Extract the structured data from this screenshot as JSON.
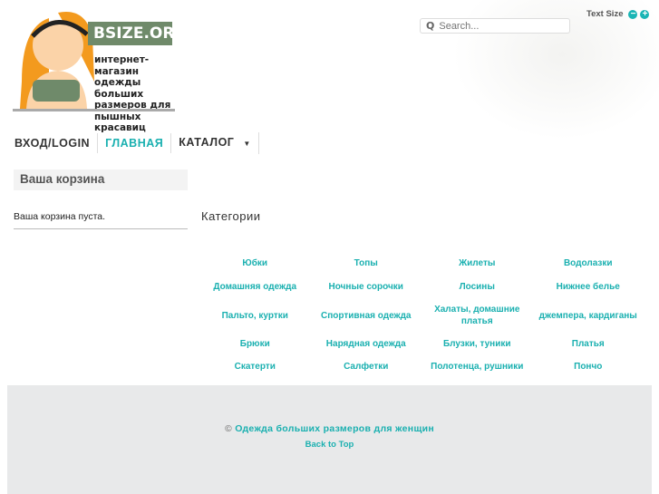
{
  "logo": {
    "title": "BSIZE.ORG",
    "tagline": "интернет-магазин одежды больших размеров для пышных красавиц"
  },
  "search": {
    "placeholder": "Search..."
  },
  "text_size": {
    "label": "Text Size",
    "minus": "−",
    "plus": "+"
  },
  "nav": [
    {
      "label": "ВХОД/LOGIN"
    },
    {
      "label": "ГЛАВНАЯ"
    },
    {
      "label": "КАТАЛОГ"
    }
  ],
  "cart": {
    "title": "Ваша корзина",
    "empty": "Ваша корзина пуста."
  },
  "categories": {
    "title": "Категории",
    "items": [
      "Юбки",
      "Топы",
      "Жилеты",
      "Водолазки",
      "Домашняя одежда",
      "Ночные сорочки",
      "Лосины",
      "Нижнее белье",
      "Пальто, куртки",
      "Спортивная одежда",
      "Халаты, домашние платья",
      "джемпера, кардиганы",
      "Брюки",
      "Нарядная одежда",
      "Блузки, туники",
      "Платья",
      "Скатерти",
      "Салфетки",
      "Полотенца, рушники",
      "Пончо"
    ]
  },
  "footer": {
    "copyright": "©",
    "site": "Одежда больших размеров для женщин",
    "back_to_top": "Back to Top"
  },
  "colors": {
    "accent": "#1ab0b0",
    "logo_green": "#6f8a6a"
  }
}
